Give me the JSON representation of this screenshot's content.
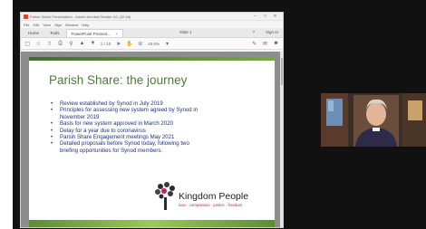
{
  "window": {
    "title": "Parish Share Presentation - Adobe Acrobat Reader DC (32-bit)",
    "controls": [
      "–",
      "□",
      "✕"
    ]
  },
  "menu": [
    "File",
    "Edit",
    "View",
    "Sign",
    "Window",
    "Help"
  ],
  "tabs": {
    "home": "Home",
    "tools": "Tools",
    "document": "PowerPoint Present...",
    "document_close": "×",
    "slide_counter": "Slide 1",
    "help_icon": "?",
    "sign_in": "Sign In"
  },
  "toolbar": {
    "page_info": "2 / 10",
    "zoom": "43.6%"
  },
  "slide": {
    "title": "Parish Share: the journey",
    "bullets": [
      "Review established by Synod in July 2019",
      "Principles for assessing new system agreed by Synod in",
      "November 2019",
      "Basis for new system approved in March 2020",
      "Delay for a year due to coronavirus",
      "Parish Share Engagement meetings May 2021",
      "Detailed proposals before Synod today, following two",
      "briefing opportunities for Synod members."
    ],
    "logo_text": "Kingdom People",
    "logo_tagline": "love · compassion · justice · freedom"
  },
  "colors": {
    "title_green": "#4e7a3a",
    "bullet_blue": "#20307a",
    "tagline_pink": "#c0205a"
  }
}
